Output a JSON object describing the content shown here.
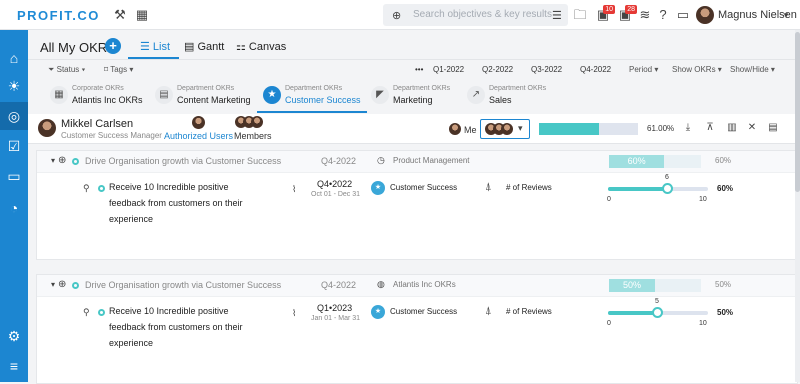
{
  "topbar": {
    "logo": "PROFIT.CO",
    "search_placeholder": "Search objectives & key results",
    "notif_badge_1": "10",
    "notif_badge_2": "28",
    "username": "Magnus Nielsen"
  },
  "header": {
    "title": "All My OKRs",
    "views": [
      "List",
      "Gantt",
      "Canvas"
    ],
    "filters": [
      "Status",
      "Tags"
    ],
    "periods": [
      "Q1-2022",
      "Q2-2022",
      "Q3-2022",
      "Q4-2022"
    ],
    "period_menu": "Period",
    "show_okrs": "Show OKRs",
    "show_hide": "Show/Hide"
  },
  "departments": [
    {
      "sub": "Corporate OKRs",
      "name": "Atlantis Inc OKRs",
      "icon": "building-icon"
    },
    {
      "sub": "Department OKRs",
      "name": "Content Marketing",
      "icon": "document-icon"
    },
    {
      "sub": "Department OKRs",
      "name": "Customer Success",
      "icon": "star-icon"
    },
    {
      "sub": "Department OKRs",
      "name": "Marketing",
      "icon": "megaphone-icon"
    },
    {
      "sub": "Department OKRs",
      "name": "Sales",
      "icon": "trend-icon"
    }
  ],
  "user": {
    "name": "Mikkel Carlsen",
    "role": "Customer Success Manager",
    "authorized": "Authorized Users",
    "members": "Members",
    "me_label": "Me",
    "progress_label": "61.00%",
    "progress_value": 0.61
  },
  "objectives": [
    {
      "title": "Drive Organisation growth via Customer Success",
      "quarter": "Q4-2022",
      "owner": "Product Management",
      "bar_label": "60%",
      "pct": "60%",
      "progress": 0.6,
      "kr": {
        "title": "Receive 10 Incredible positive feedback from customers on their experience",
        "quarter": "Q4•2022",
        "dates": "Oct 01 - Dec 31",
        "team": "Customer Success",
        "metric": "# of Reviews",
        "slider_val": "6",
        "slider_min": "0",
        "slider_max": "10",
        "slider_fraction": 0.6,
        "pct": "60%"
      }
    },
    {
      "title": "Drive Organisation growth via Customer Success",
      "quarter": "Q4-2022",
      "owner": "Atlantis Inc OKRs",
      "bar_label": "50%",
      "pct": "50%",
      "progress": 0.5,
      "kr": {
        "title": "Receive 10 Incredible positive feedback from customers on their experience",
        "quarter": "Q1•2023",
        "dates": "Jan 01 - Mar 31",
        "team": "Customer Success",
        "metric": "# of Reviews",
        "slider_val": "5",
        "slider_min": "0",
        "slider_max": "10",
        "slider_fraction": 0.5,
        "pct": "50%"
      }
    }
  ],
  "colors": {
    "brand": "#1c86d1",
    "teal": "#48c7c6"
  }
}
